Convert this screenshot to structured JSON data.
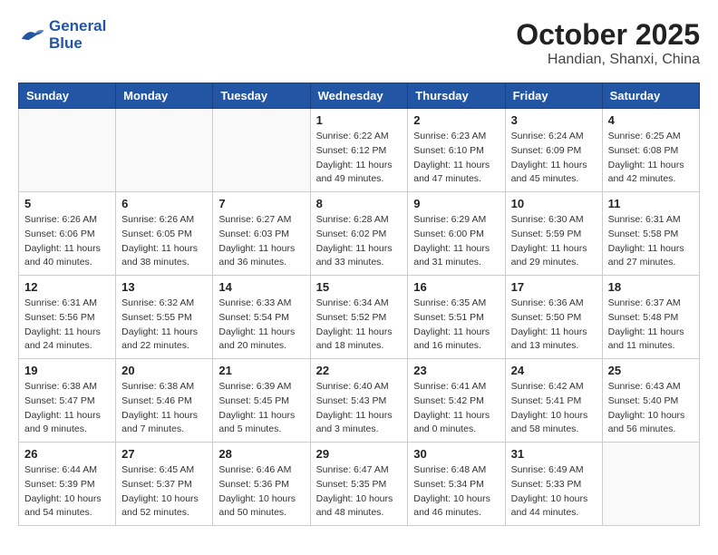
{
  "header": {
    "logo_line1": "General",
    "logo_line2": "Blue",
    "month": "October 2025",
    "location": "Handian, Shanxi, China"
  },
  "weekdays": [
    "Sunday",
    "Monday",
    "Tuesday",
    "Wednesday",
    "Thursday",
    "Friday",
    "Saturday"
  ],
  "weeks": [
    [
      {
        "day": "",
        "info": ""
      },
      {
        "day": "",
        "info": ""
      },
      {
        "day": "",
        "info": ""
      },
      {
        "day": "1",
        "info": "Sunrise: 6:22 AM\nSunset: 6:12 PM\nDaylight: 11 hours\nand 49 minutes."
      },
      {
        "day": "2",
        "info": "Sunrise: 6:23 AM\nSunset: 6:10 PM\nDaylight: 11 hours\nand 47 minutes."
      },
      {
        "day": "3",
        "info": "Sunrise: 6:24 AM\nSunset: 6:09 PM\nDaylight: 11 hours\nand 45 minutes."
      },
      {
        "day": "4",
        "info": "Sunrise: 6:25 AM\nSunset: 6:08 PM\nDaylight: 11 hours\nand 42 minutes."
      }
    ],
    [
      {
        "day": "5",
        "info": "Sunrise: 6:26 AM\nSunset: 6:06 PM\nDaylight: 11 hours\nand 40 minutes."
      },
      {
        "day": "6",
        "info": "Sunrise: 6:26 AM\nSunset: 6:05 PM\nDaylight: 11 hours\nand 38 minutes."
      },
      {
        "day": "7",
        "info": "Sunrise: 6:27 AM\nSunset: 6:03 PM\nDaylight: 11 hours\nand 36 minutes."
      },
      {
        "day": "8",
        "info": "Sunrise: 6:28 AM\nSunset: 6:02 PM\nDaylight: 11 hours\nand 33 minutes."
      },
      {
        "day": "9",
        "info": "Sunrise: 6:29 AM\nSunset: 6:00 PM\nDaylight: 11 hours\nand 31 minutes."
      },
      {
        "day": "10",
        "info": "Sunrise: 6:30 AM\nSunset: 5:59 PM\nDaylight: 11 hours\nand 29 minutes."
      },
      {
        "day": "11",
        "info": "Sunrise: 6:31 AM\nSunset: 5:58 PM\nDaylight: 11 hours\nand 27 minutes."
      }
    ],
    [
      {
        "day": "12",
        "info": "Sunrise: 6:31 AM\nSunset: 5:56 PM\nDaylight: 11 hours\nand 24 minutes."
      },
      {
        "day": "13",
        "info": "Sunrise: 6:32 AM\nSunset: 5:55 PM\nDaylight: 11 hours\nand 22 minutes."
      },
      {
        "day": "14",
        "info": "Sunrise: 6:33 AM\nSunset: 5:54 PM\nDaylight: 11 hours\nand 20 minutes."
      },
      {
        "day": "15",
        "info": "Sunrise: 6:34 AM\nSunset: 5:52 PM\nDaylight: 11 hours\nand 18 minutes."
      },
      {
        "day": "16",
        "info": "Sunrise: 6:35 AM\nSunset: 5:51 PM\nDaylight: 11 hours\nand 16 minutes."
      },
      {
        "day": "17",
        "info": "Sunrise: 6:36 AM\nSunset: 5:50 PM\nDaylight: 11 hours\nand 13 minutes."
      },
      {
        "day": "18",
        "info": "Sunrise: 6:37 AM\nSunset: 5:48 PM\nDaylight: 11 hours\nand 11 minutes."
      }
    ],
    [
      {
        "day": "19",
        "info": "Sunrise: 6:38 AM\nSunset: 5:47 PM\nDaylight: 11 hours\nand 9 minutes."
      },
      {
        "day": "20",
        "info": "Sunrise: 6:38 AM\nSunset: 5:46 PM\nDaylight: 11 hours\nand 7 minutes."
      },
      {
        "day": "21",
        "info": "Sunrise: 6:39 AM\nSunset: 5:45 PM\nDaylight: 11 hours\nand 5 minutes."
      },
      {
        "day": "22",
        "info": "Sunrise: 6:40 AM\nSunset: 5:43 PM\nDaylight: 11 hours\nand 3 minutes."
      },
      {
        "day": "23",
        "info": "Sunrise: 6:41 AM\nSunset: 5:42 PM\nDaylight: 11 hours\nand 0 minutes."
      },
      {
        "day": "24",
        "info": "Sunrise: 6:42 AM\nSunset: 5:41 PM\nDaylight: 10 hours\nand 58 minutes."
      },
      {
        "day": "25",
        "info": "Sunrise: 6:43 AM\nSunset: 5:40 PM\nDaylight: 10 hours\nand 56 minutes."
      }
    ],
    [
      {
        "day": "26",
        "info": "Sunrise: 6:44 AM\nSunset: 5:39 PM\nDaylight: 10 hours\nand 54 minutes."
      },
      {
        "day": "27",
        "info": "Sunrise: 6:45 AM\nSunset: 5:37 PM\nDaylight: 10 hours\nand 52 minutes."
      },
      {
        "day": "28",
        "info": "Sunrise: 6:46 AM\nSunset: 5:36 PM\nDaylight: 10 hours\nand 50 minutes."
      },
      {
        "day": "29",
        "info": "Sunrise: 6:47 AM\nSunset: 5:35 PM\nDaylight: 10 hours\nand 48 minutes."
      },
      {
        "day": "30",
        "info": "Sunrise: 6:48 AM\nSunset: 5:34 PM\nDaylight: 10 hours\nand 46 minutes."
      },
      {
        "day": "31",
        "info": "Sunrise: 6:49 AM\nSunset: 5:33 PM\nDaylight: 10 hours\nand 44 minutes."
      },
      {
        "day": "",
        "info": ""
      }
    ]
  ]
}
